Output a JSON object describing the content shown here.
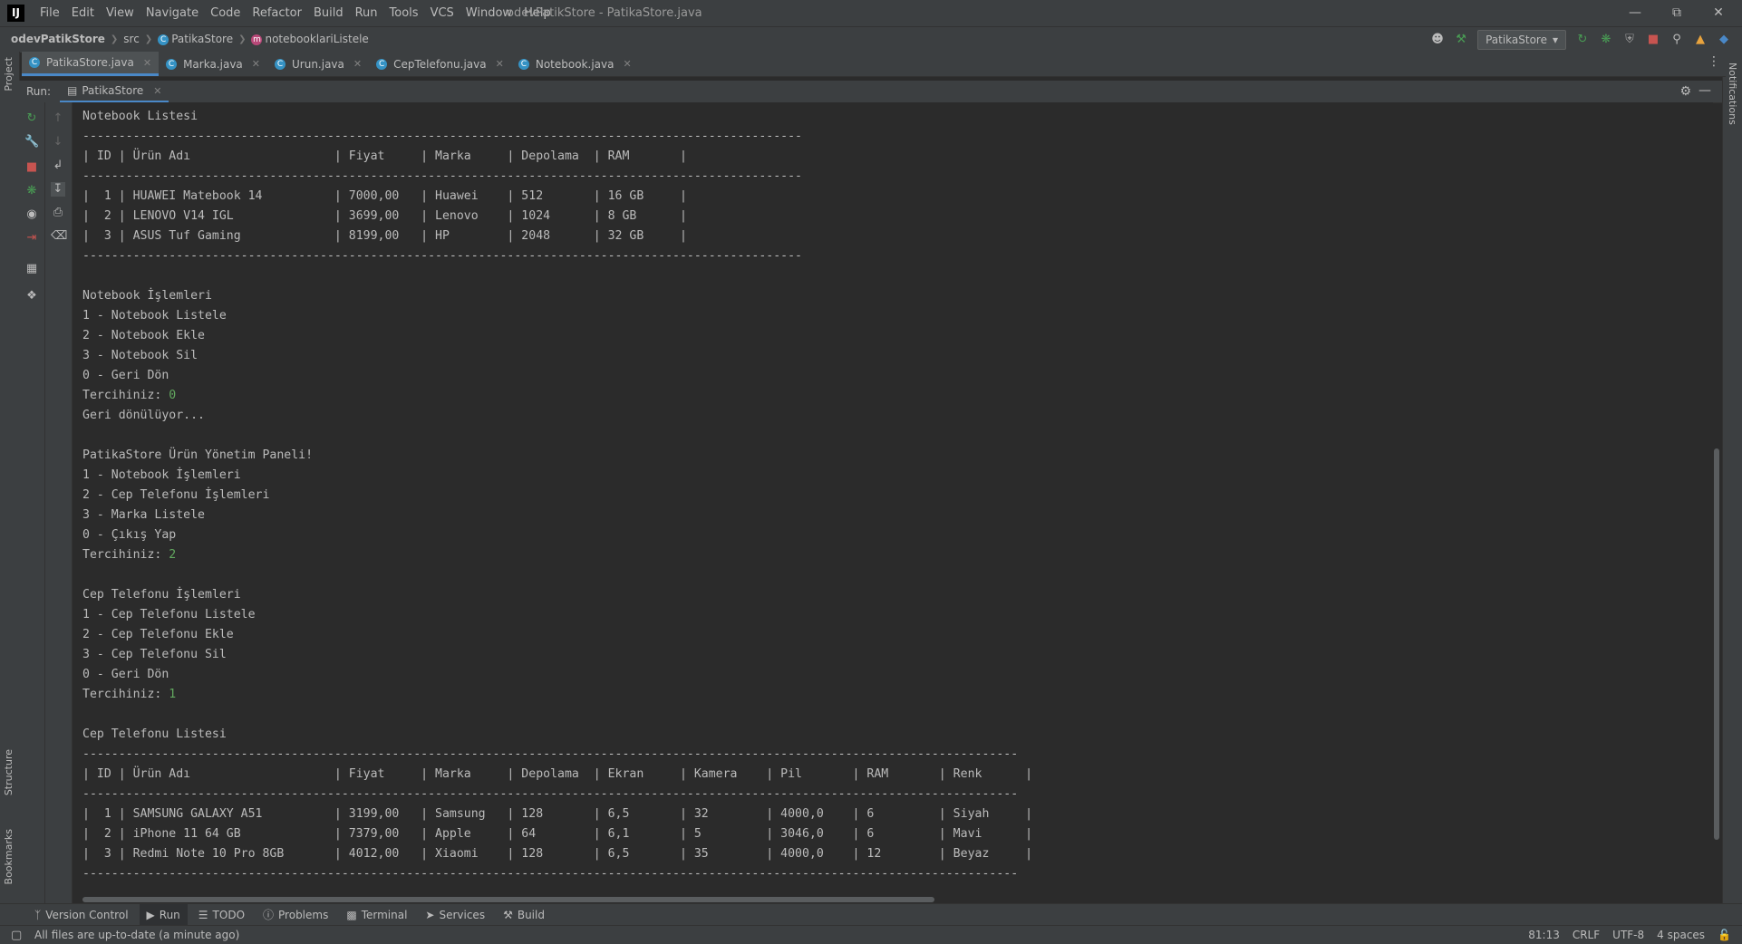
{
  "app": {
    "window_title": "odevPatikStore - PatikaStore.java",
    "menu": [
      "File",
      "Edit",
      "View",
      "Navigate",
      "Code",
      "Refactor",
      "Build",
      "Run",
      "Tools",
      "VCS",
      "Window",
      "Help"
    ]
  },
  "breadcrumb": {
    "project": "odevPatikStore",
    "folder": "src",
    "class_name": "PatikaStore",
    "method": "notebooklariListele"
  },
  "toolbar": {
    "run_config": "PatikaStore"
  },
  "editor_tabs": [
    {
      "label": "PatikaStore.java",
      "active": true
    },
    {
      "label": "Marka.java",
      "active": false
    },
    {
      "label": "Urun.java",
      "active": false
    },
    {
      "label": "CepTelefonu.java",
      "active": false
    },
    {
      "label": "Notebook.java",
      "active": false
    }
  ],
  "side_panels": {
    "left_top": "Project",
    "left_mid": "Structure",
    "left_bottom": "Bookmarks",
    "right": "Notifications"
  },
  "run_panel": {
    "label": "Run:",
    "tab": "PatikaStore"
  },
  "console": {
    "lines": [
      {
        "text": "Notebook Listesi"
      },
      {
        "text": "----------------------------------------------------------------------------------------------------"
      },
      {
        "text": "| ID | Ürün Adı                    | Fiyat     | Marka     | Depolama  | RAM       |"
      },
      {
        "text": "----------------------------------------------------------------------------------------------------"
      },
      {
        "text": "|  1 | HUAWEI Matebook 14          | 7000,00   | Huawei    | 512       | 16 GB     |"
      },
      {
        "text": "|  2 | LENOVO V14 IGL              | 3699,00   | Lenovo    | 1024      | 8 GB      |"
      },
      {
        "text": "|  3 | ASUS Tuf Gaming             | 8199,00   | HP        | 2048      | 32 GB     |"
      },
      {
        "text": "----------------------------------------------------------------------------------------------------"
      },
      {
        "text": ""
      },
      {
        "text": "Notebook İşlemleri"
      },
      {
        "text": "1 - Notebook Listele"
      },
      {
        "text": "2 - Notebook Ekle"
      },
      {
        "text": "3 - Notebook Sil"
      },
      {
        "text": "0 - Geri Dön"
      },
      {
        "text": "Tercihiniz: ",
        "input": "0"
      },
      {
        "text": "Geri dönülüyor..."
      },
      {
        "text": ""
      },
      {
        "text": "PatikaStore Ürün Yönetim Paneli!"
      },
      {
        "text": "1 - Notebook İşlemleri"
      },
      {
        "text": "2 - Cep Telefonu İşlemleri"
      },
      {
        "text": "3 - Marka Listele"
      },
      {
        "text": "0 - Çıkış Yap"
      },
      {
        "text": "Tercihiniz: ",
        "input": "2"
      },
      {
        "text": ""
      },
      {
        "text": "Cep Telefonu İşlemleri"
      },
      {
        "text": "1 - Cep Telefonu Listele"
      },
      {
        "text": "2 - Cep Telefonu Ekle"
      },
      {
        "text": "3 - Cep Telefonu Sil"
      },
      {
        "text": "0 - Geri Dön"
      },
      {
        "text": "Tercihiniz: ",
        "input": "1"
      },
      {
        "text": ""
      },
      {
        "text": "Cep Telefonu Listesi"
      },
      {
        "text": "----------------------------------------------------------------------------------------------------------------------------------"
      },
      {
        "text": "| ID | Ürün Adı                    | Fiyat     | Marka     | Depolama  | Ekran     | Kamera    | Pil       | RAM       | Renk      |"
      },
      {
        "text": "----------------------------------------------------------------------------------------------------------------------------------"
      },
      {
        "text": "|  1 | SAMSUNG GALAXY A51          | 3199,00   | Samsung   | 128       | 6,5       | 32        | 4000,0    | 6         | Siyah     |"
      },
      {
        "text": "|  2 | iPhone 11 64 GB             | 7379,00   | Apple     | 64        | 6,1       | 5         | 3046,0    | 6         | Mavi      |"
      },
      {
        "text": "|  3 | Redmi Note 10 Pro 8GB       | 4012,00   | Xiaomi    | 128       | 6,5       | 35        | 4000,0    | 12        | Beyaz     |"
      },
      {
        "text": "----------------------------------------------------------------------------------------------------------------------------------"
      }
    ]
  },
  "bottom_tabs": [
    {
      "label": "Version Control",
      "icon": "branch-icon",
      "active": false
    },
    {
      "label": "Run",
      "icon": "play-icon",
      "active": true
    },
    {
      "label": "TODO",
      "icon": "list-icon",
      "active": false
    },
    {
      "label": "Problems",
      "icon": "info-icon",
      "active": false
    },
    {
      "label": "Terminal",
      "icon": "terminal-icon",
      "active": false
    },
    {
      "label": "Services",
      "icon": "services-icon",
      "active": false
    },
    {
      "label": "Build",
      "icon": "hammer-icon",
      "active": false
    }
  ],
  "status": {
    "message": "All files are up-to-date (a minute ago)",
    "position": "81:13",
    "line_sep": "CRLF",
    "encoding": "UTF-8",
    "indent": "4 spaces"
  },
  "colors": {
    "accent": "#4a88c7",
    "user_input": "#62a85f",
    "run_green": "#499c54",
    "stop_red": "#c75450"
  }
}
